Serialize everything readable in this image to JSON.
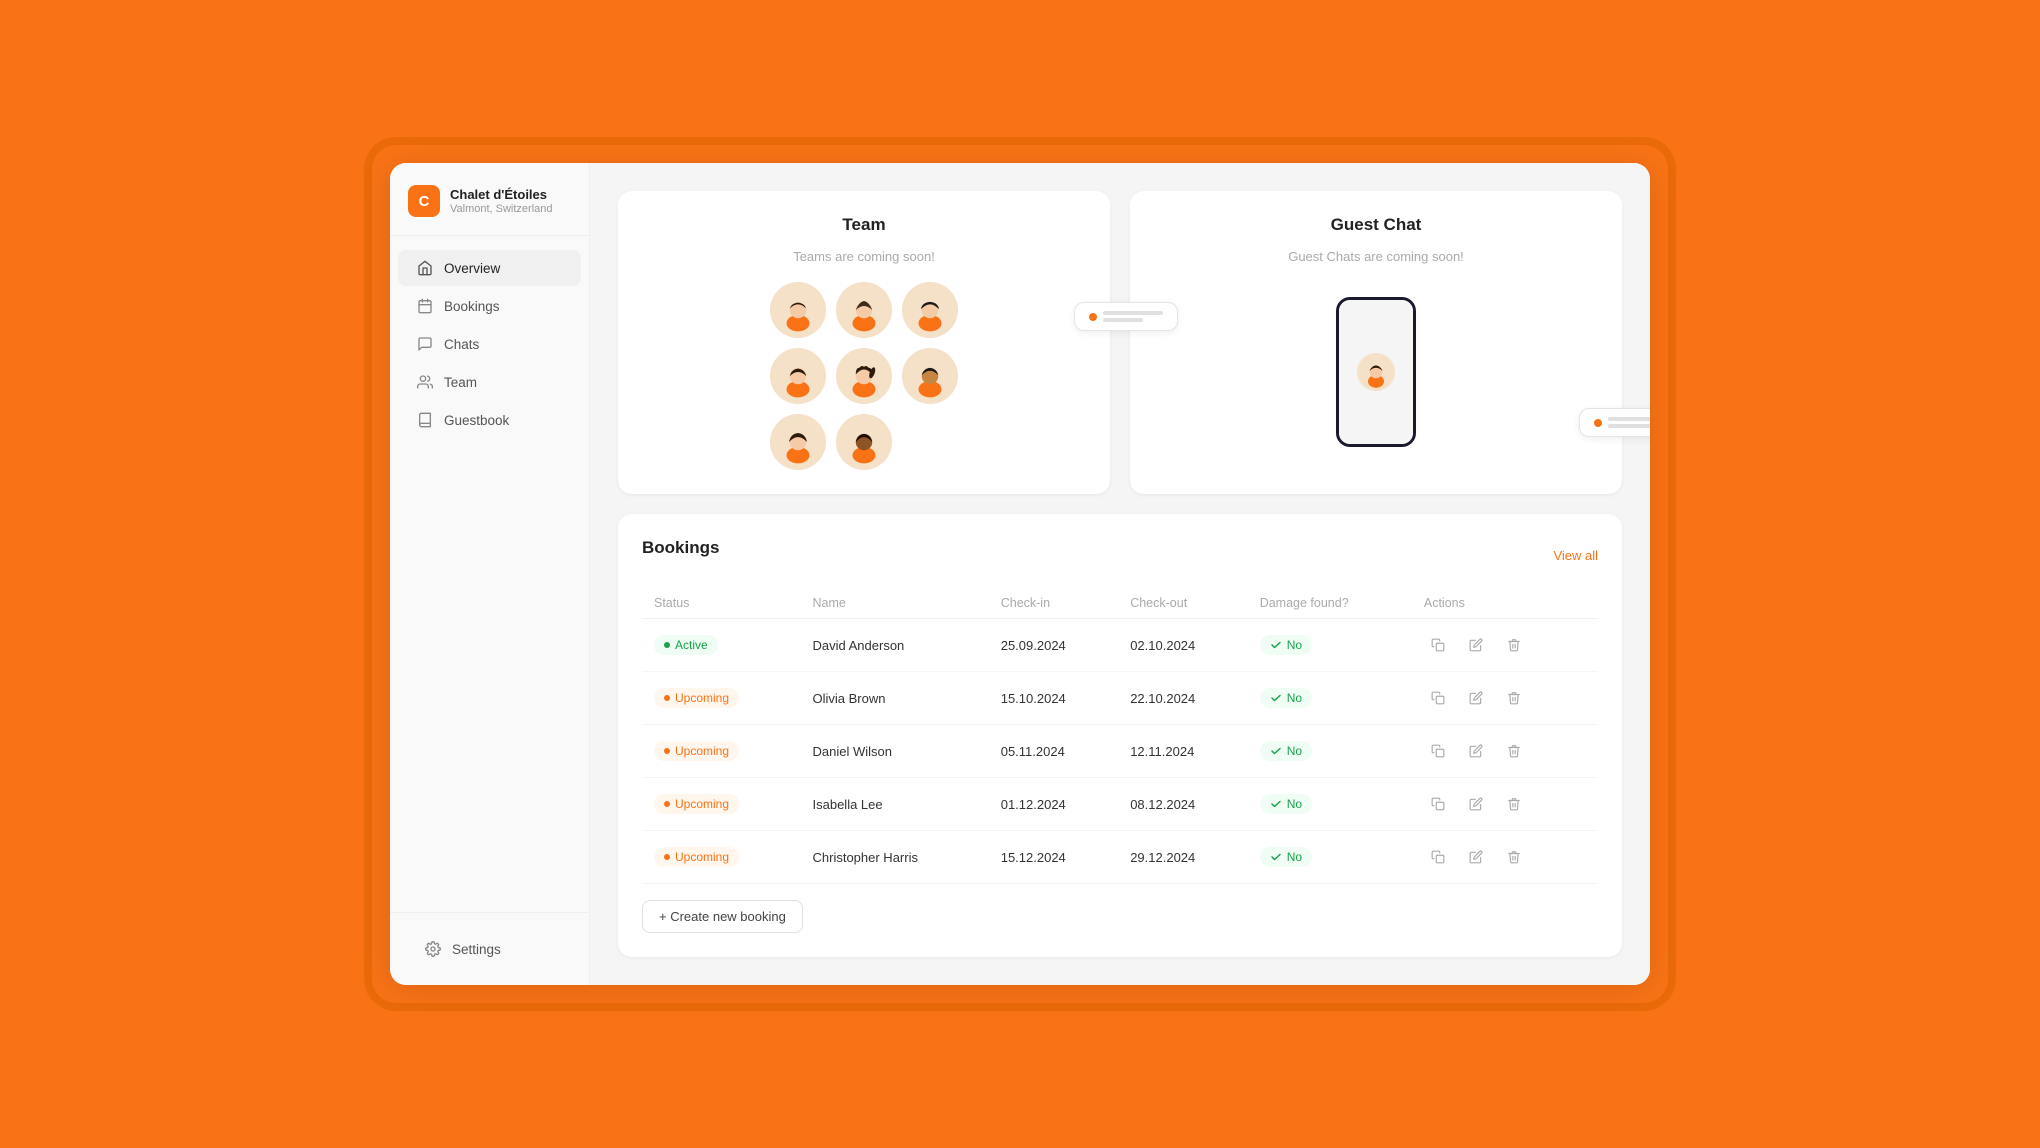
{
  "brand": {
    "initial": "C",
    "name": "Chalet d'Étoiles",
    "location": "Valmont, Switzerland"
  },
  "nav": {
    "items": [
      {
        "id": "overview",
        "label": "Overview",
        "icon": "home",
        "active": true
      },
      {
        "id": "bookings",
        "label": "Bookings",
        "icon": "calendar",
        "active": false
      },
      {
        "id": "chats",
        "label": "Chats",
        "icon": "chat",
        "active": false
      },
      {
        "id": "team",
        "label": "Team",
        "icon": "users",
        "active": false
      },
      {
        "id": "guestbook",
        "label": "Guestbook",
        "icon": "book",
        "active": false
      }
    ],
    "settings_label": "Settings"
  },
  "team_card": {
    "title": "Team",
    "coming_soon": "Teams are coming soon!"
  },
  "guest_chat_card": {
    "title": "Guest Chat",
    "coming_soon": "Guest Chats are coming soon!"
  },
  "bookings": {
    "title": "Bookings",
    "view_all": "View all",
    "columns": [
      "Status",
      "Name",
      "Check-in",
      "Check-out",
      "Damage found?",
      "Actions"
    ],
    "rows": [
      {
        "status": "Active",
        "status_type": "active",
        "name": "David Anderson",
        "checkin": "25.09.2024",
        "checkout": "02.10.2024",
        "damage": "No"
      },
      {
        "status": "Upcoming",
        "status_type": "upcoming",
        "name": "Olivia Brown",
        "checkin": "15.10.2024",
        "checkout": "22.10.2024",
        "damage": "No"
      },
      {
        "status": "Upcoming",
        "status_type": "upcoming",
        "name": "Daniel Wilson",
        "checkin": "05.11.2024",
        "checkout": "12.11.2024",
        "damage": "No"
      },
      {
        "status": "Upcoming",
        "status_type": "upcoming",
        "name": "Isabella Lee",
        "checkin": "01.12.2024",
        "checkout": "08.12.2024",
        "damage": "No"
      },
      {
        "status": "Upcoming",
        "status_type": "upcoming",
        "name": "Christopher Harris",
        "checkin": "15.12.2024",
        "checkout": "29.12.2024",
        "damage": "No"
      }
    ],
    "create_label": "+ Create new booking"
  }
}
